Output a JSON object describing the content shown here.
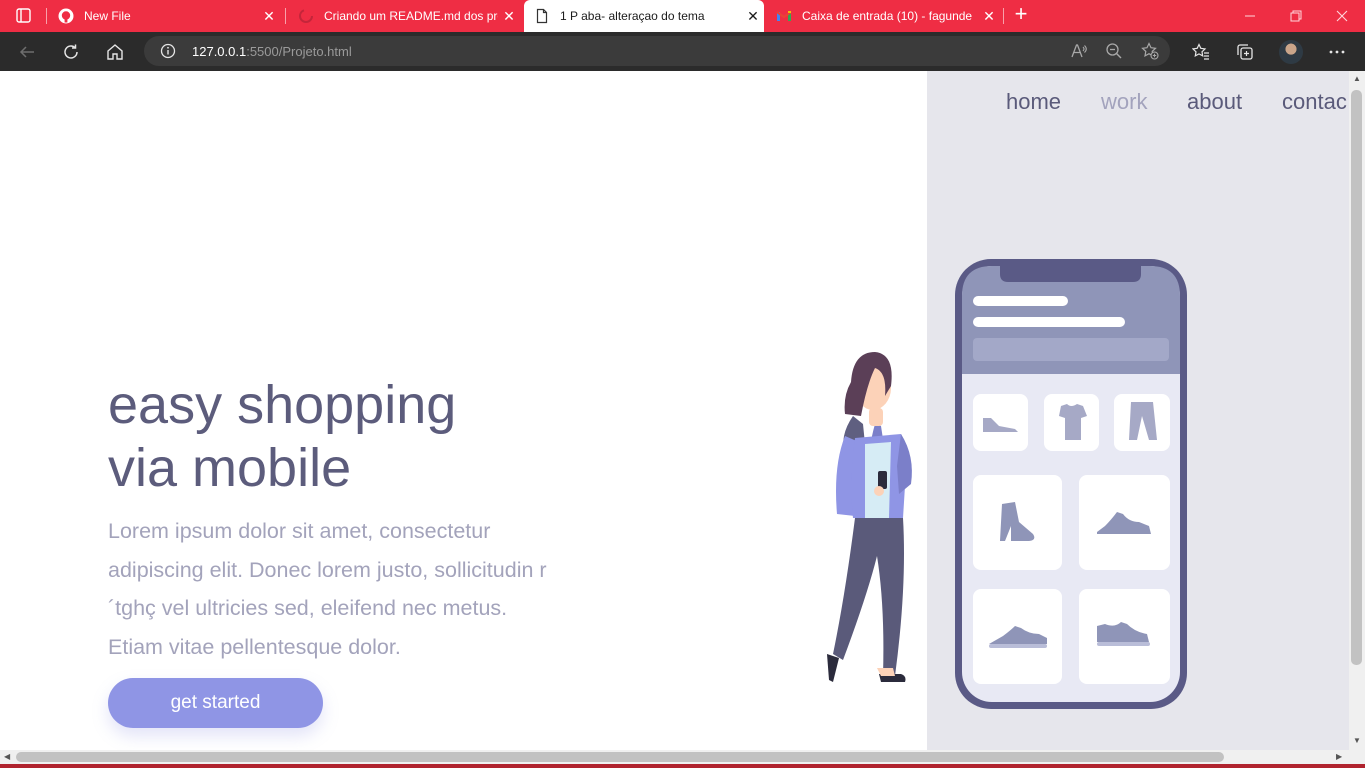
{
  "browser": {
    "tabs": [
      {
        "title": "New File",
        "icon": "github-icon",
        "active": false
      },
      {
        "title": "Criando um README.md dos pro",
        "icon": "loading-icon",
        "active": false
      },
      {
        "title": "1 P aba- alteraçao do tema",
        "icon": "page-icon",
        "active": true
      },
      {
        "title": "Caixa de entrada (10) - fagunde",
        "icon": "gmail-icon",
        "active": false
      }
    ],
    "tab_close": "✕",
    "new_tab": "+",
    "url_host": "127.0.0.1",
    "url_rest": ":5500/Projeto.html",
    "accent": "#ef2d44"
  },
  "site": {
    "nav": {
      "home": "home",
      "work": "work",
      "about": "about",
      "contact": "contac"
    },
    "hero": {
      "title_line1": "easy shopping",
      "title_line2": "via mobile",
      "text": "Lorem ipsum dolor sit amet, consectetur adipiscing elit. Donec lorem justo, sollicitudin r´tghç vel ultricies sed, eleifend nec metus. Etiam vitae pellentesque dolor.",
      "cta": "get started"
    },
    "colors": {
      "title": "#5c5c7c",
      "text": "#a3a3bb",
      "button": "#8f95e5",
      "panel": "#e6e6ec"
    }
  }
}
